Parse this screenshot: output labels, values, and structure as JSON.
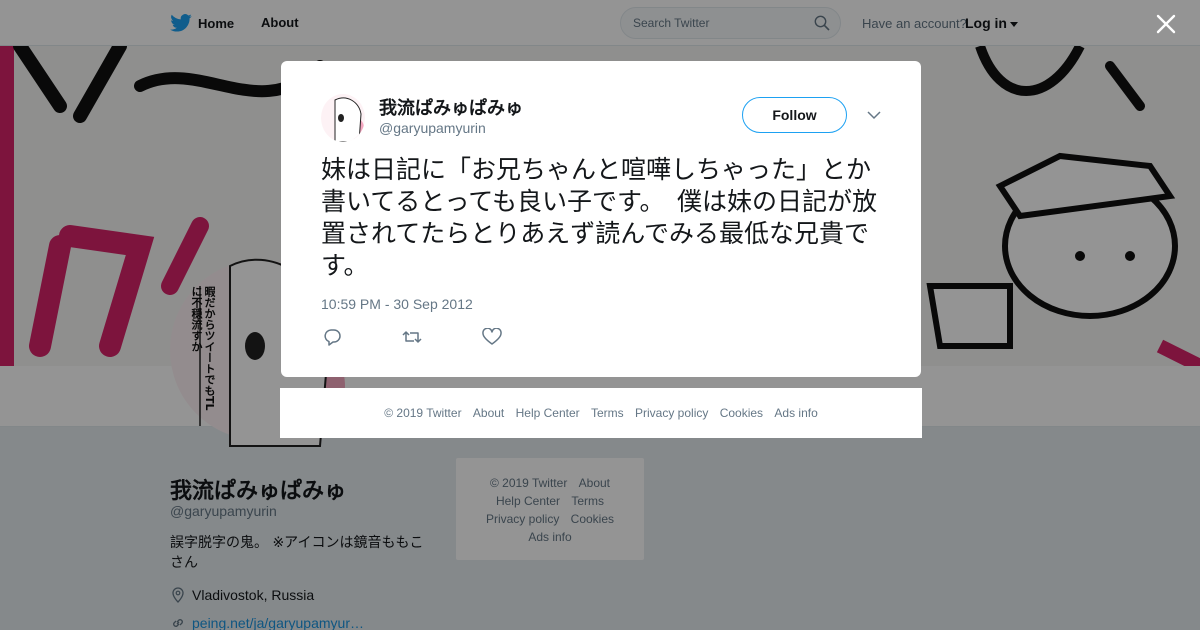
{
  "nav": {
    "home_label": "Home",
    "about_label": "About",
    "search_placeholder": "Search Twitter",
    "have_account": "Have an account?",
    "login_label": "Log in"
  },
  "profile": {
    "name": "我流ぱみゅぱみゅ",
    "handle": "@garyupamyurin",
    "bio": "誤字脱字の鬼。 ※アイコンは鏡音ももこさん",
    "location": "Vladivostok, Russia",
    "website": "peing.net/ja/garyupamyur…",
    "avatar_bubble_text": "暇だからツイートでもTLに不穏流すか"
  },
  "side_footer": {
    "copyright": "© 2019 Twitter",
    "about": "About",
    "help": "Help Center",
    "terms": "Terms",
    "privacy": "Privacy policy",
    "cookies": "Cookies",
    "ads": "Ads info"
  },
  "tweet": {
    "author_name": "我流ぱみゅぱみゅ",
    "author_handle": "@garyupamyurin",
    "follow_label": "Follow",
    "text": "妹は日記に「お兄ちゃんと喧嘩しちゃった」とか書いてるとっても良い子です。　僕は妹の日記が放置されてたらとりあえず読んでみる最低な兄貴です。",
    "timestamp": "10:59 PM - 30 Sep 2012"
  },
  "modal_footer": {
    "copyright": "© 2019 Twitter",
    "about": "About",
    "help": "Help Center",
    "terms": "Terms",
    "privacy": "Privacy policy",
    "cookies": "Cookies",
    "ads": "Ads info"
  },
  "icons": {
    "logo": "twitter-bird-icon",
    "close": "close-icon",
    "reply": "reply-icon",
    "retweet": "retweet-icon",
    "like": "heart-icon"
  },
  "colors": {
    "brand": "#1da1f2",
    "banner_accent": "#d8246a",
    "text_primary": "#14171a",
    "text_secondary": "#657786"
  }
}
